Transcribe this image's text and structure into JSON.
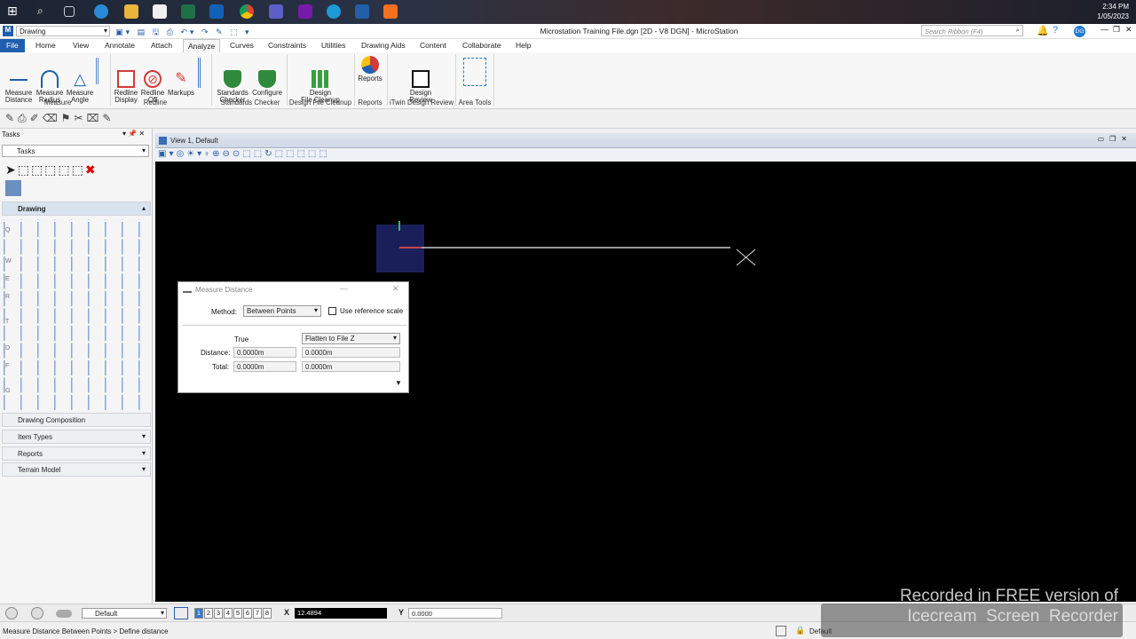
{
  "taskbar": {
    "time": "2:34 PM",
    "date": "1/05/2023"
  },
  "titlebar": {
    "workflow": "Drawing",
    "title": "Microstation Training File.dgn [2D - V8 DGN] - MicroStation",
    "search_placeholder": "Search Ribbon (F4)",
    "user": "DG"
  },
  "ribbon_tabs": [
    "File",
    "Home",
    "View",
    "Annotate",
    "Attach",
    "Analyze",
    "Curves",
    "Constraints",
    "Utilities",
    "Drawing Aids",
    "Content",
    "Collaborate",
    "Help"
  ],
  "ribbon": {
    "measure": {
      "distance": "Measure\nDistance",
      "radius": "Measure\nRadius",
      "angle": "Measure\nAngle",
      "group": "Measure"
    },
    "redline": {
      "display": "Redline\nDisplay",
      "off": "Redline\nOff",
      "markups": "Markups",
      "group": "Redline"
    },
    "standards": {
      "checker": "Standards\nChecker",
      "configure": "Configure",
      "group": "Standards Checker"
    },
    "cleanup": {
      "label": "Design\nFile Cleanup",
      "group": "Design File Cleanup"
    },
    "reports": {
      "label": "Reports",
      "group": "Reports"
    },
    "review": {
      "label": "Design\nReview",
      "group": "iTwin Design Review"
    },
    "area": {
      "group": "Area Tools"
    }
  },
  "tasks": {
    "title": "Tasks",
    "dropdown": "Tasks",
    "drawing": "Drawing",
    "sections": [
      "Drawing Composition",
      "Item Types",
      "Reports",
      "Terrain Model"
    ],
    "row_keys": [
      "Q",
      "W",
      "E",
      "R",
      "T",
      "D",
      "F",
      "G"
    ]
  },
  "view": {
    "title": "View 1, Default"
  },
  "dialog": {
    "title": "Measure Distance",
    "method_label": "Method:",
    "method_value": "Between Points",
    "use_ref": "Use reference scale",
    "true_label": "True",
    "flatten": "Flatten to File Z",
    "distance_label": "Distance:",
    "total_label": "Total:",
    "distance_true": "0.0000m",
    "distance_flat": "0.0000m",
    "total_true": "0.0000m",
    "total_flat": "0.0000m"
  },
  "status": {
    "level": "Default",
    "views": [
      "1",
      "2",
      "3",
      "4",
      "5",
      "6",
      "7",
      "8"
    ],
    "x_label": "X",
    "x_value": "12.4894",
    "y_label": "Y",
    "y_value": "0.0000"
  },
  "bottom": {
    "prompt": "Measure Distance Between Points > Define distance",
    "level": "Default"
  },
  "watermark": {
    "line1": "Recorded in FREE version of",
    "line2": "Icecream  Screen  Recorder"
  }
}
